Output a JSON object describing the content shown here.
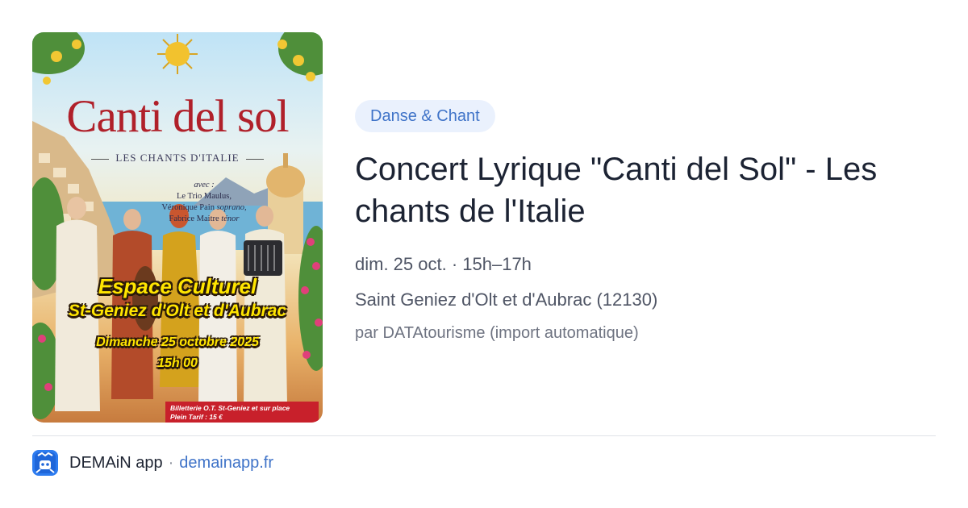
{
  "poster": {
    "title": "Canti del sol",
    "subtitle": "LES CHANTS D'ITALIE",
    "avec": "avec :",
    "artist1": "Le Trio Maulus,",
    "artist2_name": "Véronique Pain",
    "artist2_role": "soprano,",
    "artist3_name": "Fabrice Maitre",
    "artist3_role": "ténor",
    "venue_line1": "Espace Culturel",
    "venue_line2": "St-Geniez d'Olt et d'Aubrac",
    "date_line": "Dimanche 25 octobre 2025",
    "time_line": "15h 00",
    "ticket_line1": "Billetterie O.T. St-Geniez et sur place",
    "ticket_line2": "Plein Tarif : 15 €"
  },
  "event": {
    "category": "Danse & Chant",
    "title": "Concert Lyrique \"Canti del Sol\" - Les chants de l'Italie",
    "datetime": "dim. 25 oct. · 15h–17h",
    "location": "Saint Geniez d'Olt et d'Aubrac (12130)",
    "source": "par DATAtourisme (import automatique)"
  },
  "footer": {
    "app_name": "DEMAiN app",
    "separator": "·",
    "domain": "demainapp.fr",
    "logo_icon": "demain-app-logo-icon"
  },
  "colors": {
    "accent": "#3f73c8",
    "tag_bg": "#eaf1fd",
    "title": "#1c2333",
    "meta": "#4f5565",
    "poster_red": "#b0202a",
    "poster_yellow": "#ffe500"
  }
}
